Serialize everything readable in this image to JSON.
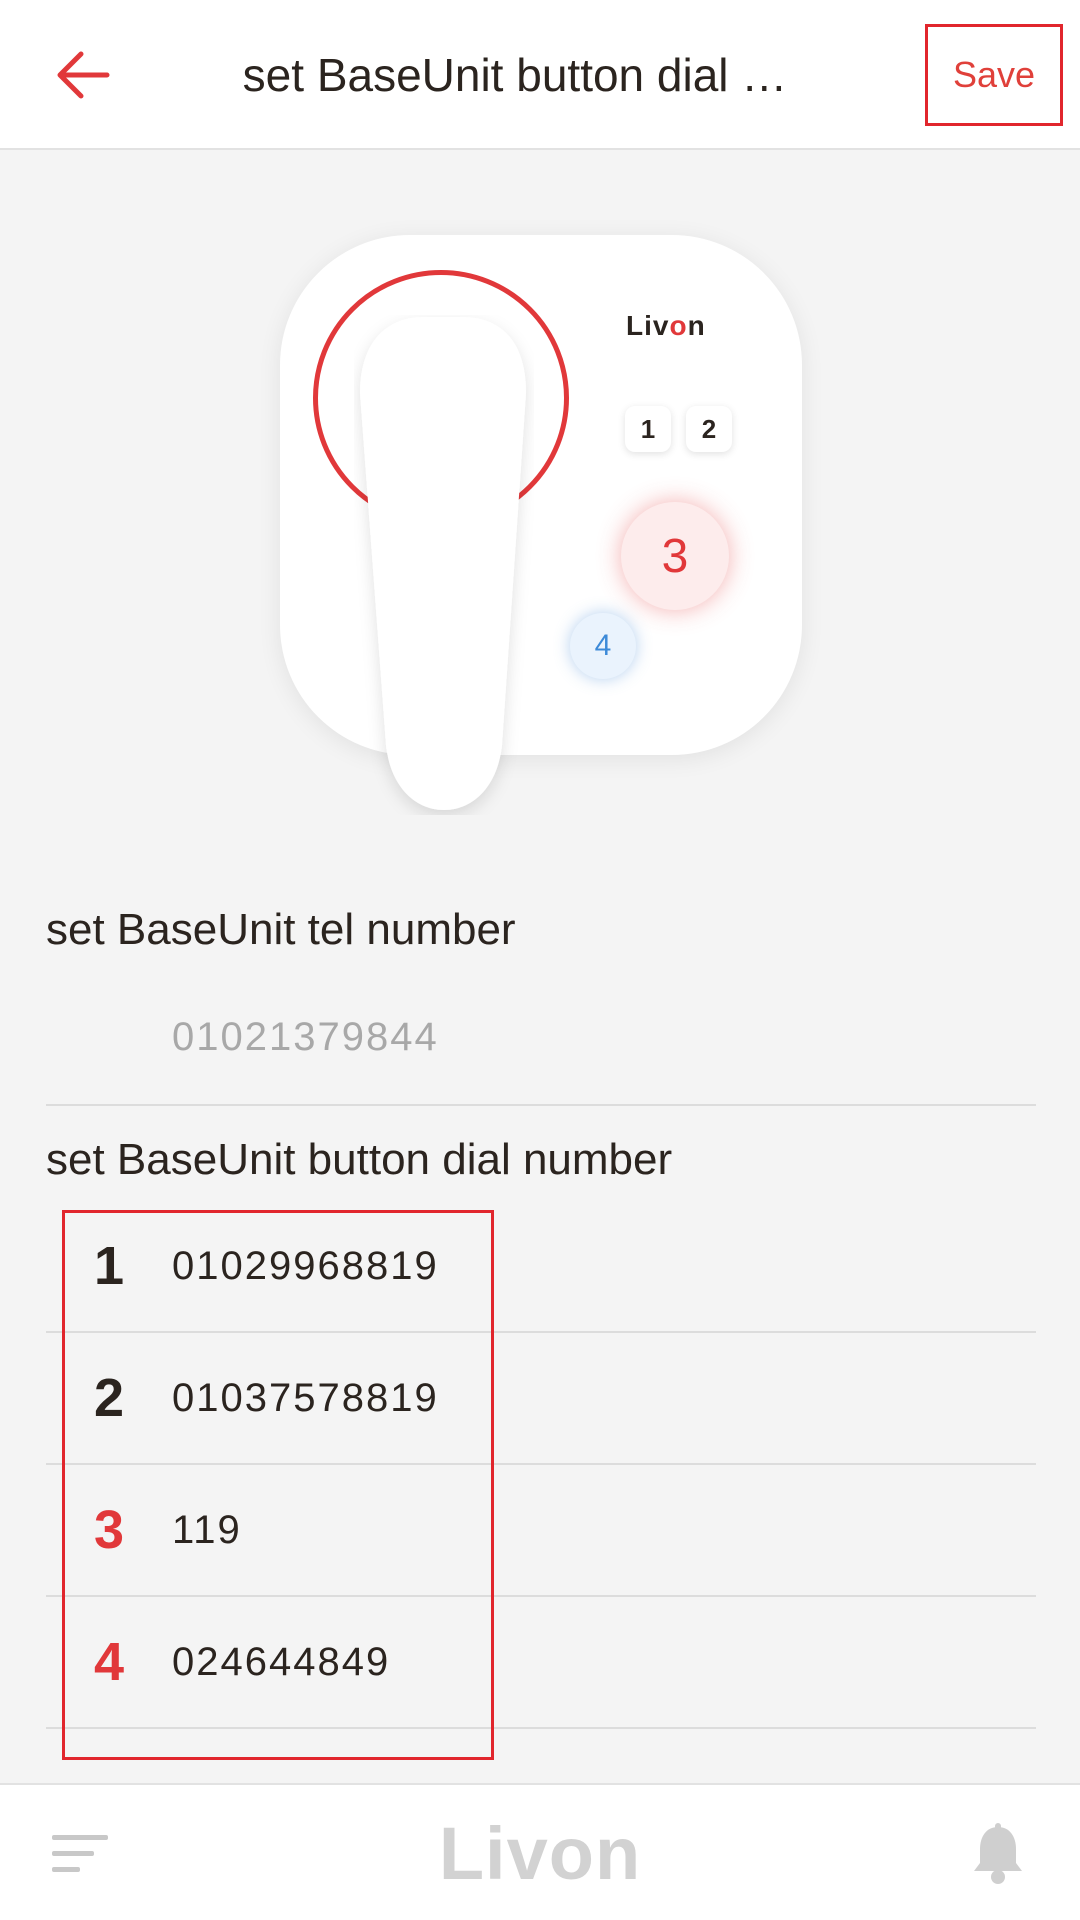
{
  "header": {
    "title": "set BaseUnit button dial …",
    "save_label": "Save"
  },
  "device": {
    "logo_prefix": "Liv",
    "logo_o": "o",
    "logo_suffix": "n",
    "keys": [
      "1",
      "2"
    ],
    "button3_label": "3",
    "button4_label": "4"
  },
  "tel_section": {
    "title": "set BaseUnit tel number",
    "value": "01021379844"
  },
  "dial_section": {
    "title": "set BaseUnit button dial number",
    "rows": [
      {
        "index": "1",
        "number": "01029968819",
        "index_color": "#2b241f"
      },
      {
        "index": "2",
        "number": "01037578819",
        "index_color": "#2b241f"
      },
      {
        "index": "3",
        "number": "119",
        "index_color": "#e1383a"
      },
      {
        "index": "4",
        "number": "024644849",
        "index_color": "#e1383a"
      }
    ]
  },
  "bottom_bar": {
    "logo_prefix": "Liv",
    "logo_o": "o",
    "logo_suffix": "n"
  },
  "colors": {
    "accent": "#e1383a",
    "highlight_border": "#e1262d",
    "background": "#f4f4f4"
  },
  "icons": {
    "back": "arrow-left-icon",
    "menu": "menu-icon",
    "bell": "bell-icon"
  }
}
